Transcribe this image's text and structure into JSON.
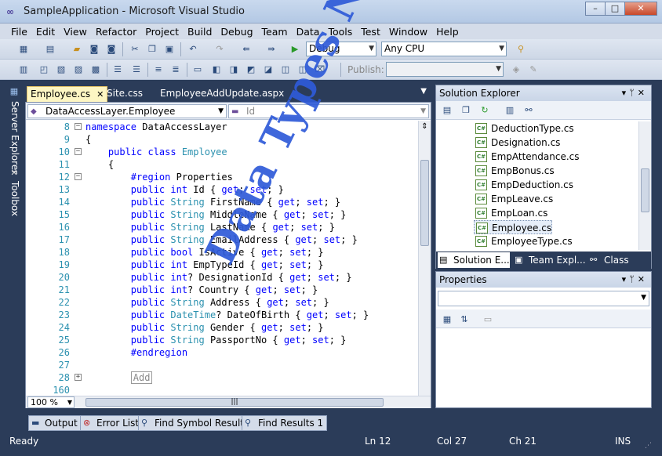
{
  "window": {
    "title": "SampleApplication - Microsoft Visual Studio",
    "min": "–",
    "max": "□",
    "close": "✕"
  },
  "menu": [
    "File",
    "Edit",
    "View",
    "Refactor",
    "Project",
    "Build",
    "Debug",
    "Team",
    "Data",
    "Tools",
    "Test",
    "Window",
    "Help"
  ],
  "toolbar": {
    "config": "Debug",
    "platform": "Any CPU",
    "publish_label": "Publish:"
  },
  "left_tabs": {
    "server_explorer": "Server Explorer",
    "toolbox": "Toolbox"
  },
  "doc_tabs": [
    {
      "label": "Employee.cs",
      "active": true
    },
    {
      "label": "Site.css",
      "active": false
    },
    {
      "label": "EmployeeAddUpdate.aspx",
      "active": false
    }
  ],
  "nav": {
    "type_combo": "DataAccessLayer.Employee",
    "member_combo": "Id"
  },
  "code_lines": [
    {
      "n": "8",
      "fold": "-",
      "tokens": [
        {
          "t": "namespace ",
          "c": "kw"
        },
        {
          "t": "DataAccessLayer",
          "c": ""
        }
      ]
    },
    {
      "n": "9",
      "fold": "",
      "tokens": [
        {
          "t": "{",
          "c": ""
        }
      ]
    },
    {
      "n": "10",
      "fold": "-",
      "tokens": [
        {
          "t": "    public class ",
          "c": "kw"
        },
        {
          "t": "Employee",
          "c": "ty"
        }
      ]
    },
    {
      "n": "11",
      "fold": "",
      "tokens": [
        {
          "t": "    {",
          "c": ""
        }
      ]
    },
    {
      "n": "12",
      "fold": "-",
      "tokens": [
        {
          "t": "        #region ",
          "c": "kw"
        },
        {
          "t": "Properties",
          "c": ""
        }
      ]
    },
    {
      "n": "13",
      "fold": "",
      "tokens": [
        {
          "t": "        public int ",
          "c": "kw"
        },
        {
          "t": "Id { ",
          "c": ""
        },
        {
          "t": "get",
          "c": "kw"
        },
        {
          "t": "; ",
          "c": ""
        },
        {
          "t": "set",
          "c": "kw"
        },
        {
          "t": "; }",
          "c": ""
        }
      ]
    },
    {
      "n": "14",
      "fold": "",
      "tokens": [
        {
          "t": "        public ",
          "c": "kw"
        },
        {
          "t": "String ",
          "c": "ty"
        },
        {
          "t": "FirstName { ",
          "c": ""
        },
        {
          "t": "get",
          "c": "kw"
        },
        {
          "t": "; ",
          "c": ""
        },
        {
          "t": "set",
          "c": "kw"
        },
        {
          "t": "; }",
          "c": ""
        }
      ]
    },
    {
      "n": "15",
      "fold": "",
      "tokens": [
        {
          "t": "        public ",
          "c": "kw"
        },
        {
          "t": "String ",
          "c": "ty"
        },
        {
          "t": "MiddleName { ",
          "c": ""
        },
        {
          "t": "get",
          "c": "kw"
        },
        {
          "t": "; ",
          "c": ""
        },
        {
          "t": "set",
          "c": "kw"
        },
        {
          "t": "; }",
          "c": ""
        }
      ]
    },
    {
      "n": "16",
      "fold": "",
      "tokens": [
        {
          "t": "        public ",
          "c": "kw"
        },
        {
          "t": "String ",
          "c": "ty"
        },
        {
          "t": "LastName { ",
          "c": ""
        },
        {
          "t": "get",
          "c": "kw"
        },
        {
          "t": "; ",
          "c": ""
        },
        {
          "t": "set",
          "c": "kw"
        },
        {
          "t": "; }",
          "c": ""
        }
      ]
    },
    {
      "n": "17",
      "fold": "",
      "tokens": [
        {
          "t": "        public ",
          "c": "kw"
        },
        {
          "t": "String ",
          "c": "ty"
        },
        {
          "t": "EmailAddress { ",
          "c": ""
        },
        {
          "t": "get",
          "c": "kw"
        },
        {
          "t": "; ",
          "c": ""
        },
        {
          "t": "set",
          "c": "kw"
        },
        {
          "t": "; }",
          "c": ""
        }
      ]
    },
    {
      "n": "18",
      "fold": "",
      "tokens": [
        {
          "t": "        public bool ",
          "c": "kw"
        },
        {
          "t": "IsActive { ",
          "c": ""
        },
        {
          "t": "get",
          "c": "kw"
        },
        {
          "t": "; ",
          "c": ""
        },
        {
          "t": "set",
          "c": "kw"
        },
        {
          "t": "; }",
          "c": ""
        }
      ]
    },
    {
      "n": "19",
      "fold": "",
      "tokens": [
        {
          "t": "        public int ",
          "c": "kw"
        },
        {
          "t": "EmpTypeId { ",
          "c": ""
        },
        {
          "t": "get",
          "c": "kw"
        },
        {
          "t": "; ",
          "c": ""
        },
        {
          "t": "set",
          "c": "kw"
        },
        {
          "t": "; }",
          "c": ""
        }
      ]
    },
    {
      "n": "20",
      "fold": "",
      "tokens": [
        {
          "t": "        public int",
          "c": "kw"
        },
        {
          "t": "? DesignationId { ",
          "c": ""
        },
        {
          "t": "get",
          "c": "kw"
        },
        {
          "t": "; ",
          "c": ""
        },
        {
          "t": "set",
          "c": "kw"
        },
        {
          "t": "; }",
          "c": ""
        }
      ]
    },
    {
      "n": "21",
      "fold": "",
      "tokens": [
        {
          "t": "        public int",
          "c": "kw"
        },
        {
          "t": "? Country { ",
          "c": ""
        },
        {
          "t": "get",
          "c": "kw"
        },
        {
          "t": "; ",
          "c": ""
        },
        {
          "t": "set",
          "c": "kw"
        },
        {
          "t": "; }",
          "c": ""
        }
      ]
    },
    {
      "n": "22",
      "fold": "",
      "tokens": [
        {
          "t": "        public ",
          "c": "kw"
        },
        {
          "t": "String ",
          "c": "ty"
        },
        {
          "t": "Address { ",
          "c": ""
        },
        {
          "t": "get",
          "c": "kw"
        },
        {
          "t": "; ",
          "c": ""
        },
        {
          "t": "set",
          "c": "kw"
        },
        {
          "t": "; }",
          "c": ""
        }
      ]
    },
    {
      "n": "23",
      "fold": "",
      "tokens": [
        {
          "t": "        public ",
          "c": "kw"
        },
        {
          "t": "DateTime",
          "c": "ty"
        },
        {
          "t": "? DateOfBirth { ",
          "c": ""
        },
        {
          "t": "get",
          "c": "kw"
        },
        {
          "t": "; ",
          "c": ""
        },
        {
          "t": "set",
          "c": "kw"
        },
        {
          "t": "; }",
          "c": ""
        }
      ]
    },
    {
      "n": "24",
      "fold": "",
      "tokens": [
        {
          "t": "        public ",
          "c": "kw"
        },
        {
          "t": "String ",
          "c": "ty"
        },
        {
          "t": "Gender { ",
          "c": ""
        },
        {
          "t": "get",
          "c": "kw"
        },
        {
          "t": "; ",
          "c": ""
        },
        {
          "t": "set",
          "c": "kw"
        },
        {
          "t": "; }",
          "c": ""
        }
      ]
    },
    {
      "n": "25",
      "fold": "",
      "tokens": [
        {
          "t": "        public ",
          "c": "kw"
        },
        {
          "t": "String ",
          "c": "ty"
        },
        {
          "t": "PassportNo { ",
          "c": ""
        },
        {
          "t": "get",
          "c": "kw"
        },
        {
          "t": "; ",
          "c": ""
        },
        {
          "t": "set",
          "c": "kw"
        },
        {
          "t": "; }",
          "c": ""
        }
      ]
    },
    {
      "n": "26",
      "fold": "",
      "tokens": [
        {
          "t": "        #endregion",
          "c": "kw"
        }
      ]
    },
    {
      "n": "27",
      "fold": "",
      "tokens": []
    },
    {
      "n": "28",
      "fold": "+",
      "tokens": [
        {
          "t": "        ",
          "c": ""
        },
        {
          "t": "Add",
          "c": "box"
        }
      ]
    },
    {
      "n": "160",
      "fold": "",
      "tokens": []
    }
  ],
  "editor": {
    "zoom": "100 %"
  },
  "solution_explorer": {
    "title": "Solution Explorer",
    "items": [
      {
        "label": "DeductionType.cs",
        "selected": false
      },
      {
        "label": "Designation.cs",
        "selected": false
      },
      {
        "label": "EmpAttendance.cs",
        "selected": false
      },
      {
        "label": "EmpBonus.cs",
        "selected": false
      },
      {
        "label": "EmpDeduction.cs",
        "selected": false
      },
      {
        "label": "EmpLeave.cs",
        "selected": false
      },
      {
        "label": "EmpLoan.cs",
        "selected": false
      },
      {
        "label": "Employee.cs",
        "selected": true
      },
      {
        "label": "EmployeeType.cs",
        "selected": false
      }
    ],
    "file_icon_text": "C#",
    "tabs": [
      {
        "label": "Solution E...",
        "active": true
      },
      {
        "label": "Team Expl...",
        "active": false
      },
      {
        "label": "Class View",
        "active": false
      }
    ]
  },
  "properties": {
    "title": "Properties"
  },
  "tool_tabs": [
    "Output",
    "Error List",
    "Find Symbol Results",
    "Find Results 1"
  ],
  "status": {
    "state": "Ready",
    "line": "Ln 12",
    "col": "Col 27",
    "ch": "Ch 21",
    "mode": "INS"
  },
  "watermark": "Data Types Nicely Handled",
  "colors": {
    "keyword": "#0000ff",
    "type": "#2b91af",
    "linenumber": "#2b91af",
    "chrome": "#2b3c59",
    "watermark": "#2f5bd8"
  }
}
